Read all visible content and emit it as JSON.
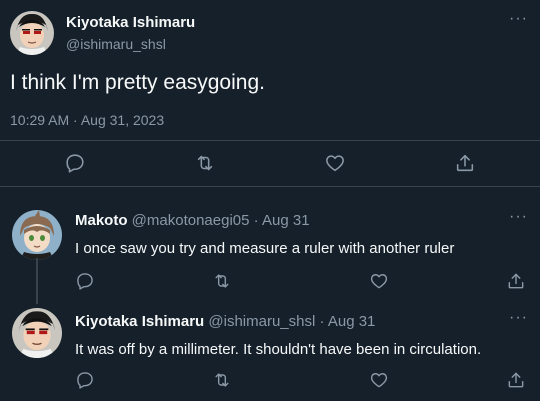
{
  "main_tweet": {
    "display_name": "Kiyotaka Ishimaru",
    "handle": "@ishimaru_shsl",
    "text": "I think I'm pretty easygoing.",
    "timestamp": "10:29 AM · Aug 31, 2023",
    "more_label": "···"
  },
  "replies": [
    {
      "display_name": "Makoto",
      "handle": "@makotonaegi05",
      "separator": "·",
      "date": "Aug 31",
      "text": "I once saw you try and measure a ruler with another ruler",
      "more_label": "···"
    },
    {
      "display_name": "Kiyotaka Ishimaru",
      "handle": "@ishimaru_shsl",
      "separator": "·",
      "date": "Aug 31",
      "text": "It was off by a millimeter. It shouldn't have been in circulation.",
      "more_label": "···"
    }
  ],
  "icons": [
    "reply-icon",
    "retweet-icon",
    "like-icon",
    "share-icon",
    "more-icon",
    "avatar"
  ],
  "colors": {
    "background": "#15202b",
    "text": "#f7f9f9",
    "muted": "#8b98a5",
    "divider": "#38444d"
  }
}
